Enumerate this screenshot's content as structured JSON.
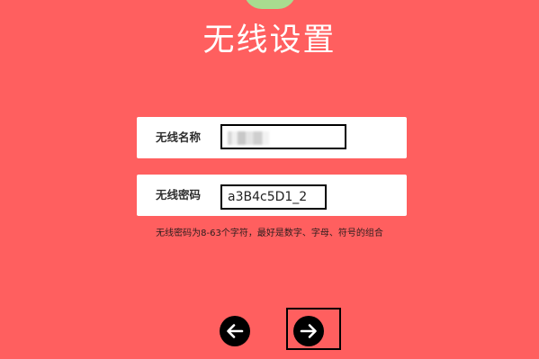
{
  "page": {
    "title": "无线设置"
  },
  "form": {
    "wireless_name": {
      "label": "无线名称",
      "value": ""
    },
    "wireless_password": {
      "label": "无线密码",
      "value": "a3B4c5D1_2"
    },
    "hint": "无线密码为8-63个字符，最好是数字、字母、符号的组合"
  },
  "navigation": {
    "previous_icon": "arrow-left-icon",
    "next_icon": "arrow-right-icon"
  },
  "colors": {
    "background": "#ff5f5f",
    "card": "#ffffff",
    "nav_button": "#000000"
  }
}
